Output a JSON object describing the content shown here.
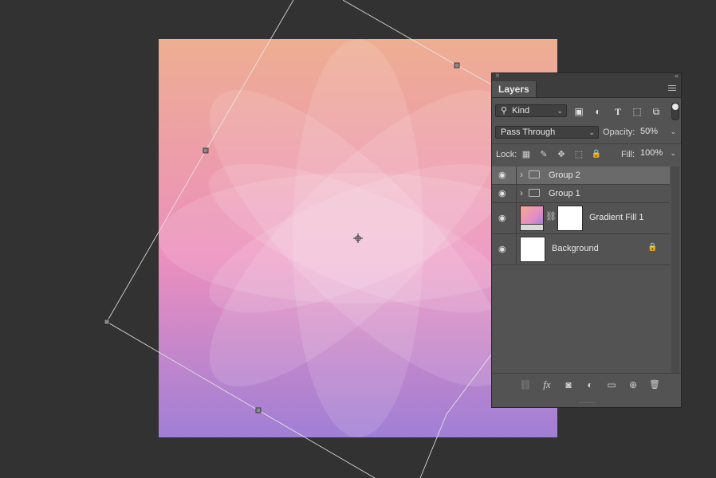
{
  "canvas": {
    "gradient": {
      "top": "#eeae92",
      "middle": "#ec8fbe",
      "bottom": "#a07fd6"
    }
  },
  "panel": {
    "close_glyph": "×",
    "collapse_glyph": "‹‹",
    "tab_label": "Layers",
    "filter": {
      "kind_label": "Kind",
      "search_icon": "⚲",
      "icons": [
        "image-filter-icon",
        "adjustment-filter-icon",
        "type-filter-icon",
        "shape-filter-icon",
        "smart-object-filter-icon"
      ],
      "glyphs": {
        "image": "▣",
        "adjustment": "◐",
        "type": "T",
        "shape": "⬚",
        "smart": "⧉"
      }
    },
    "blend_mode": "Pass Through",
    "opacity_label": "Opacity:",
    "opacity_value": "50%",
    "lock_label": "Lock:",
    "lock_glyphs": {
      "transparent": "▦",
      "brush": "✎",
      "move": "✥",
      "artboard": "⬚",
      "all": "🔒"
    },
    "fill_label": "Fill:",
    "fill_value": "100%",
    "layers": [
      {
        "name": "Group 2",
        "type": "group",
        "selected": true
      },
      {
        "name": "Group 1",
        "type": "group",
        "selected": false
      },
      {
        "name": "Gradient Fill 1",
        "type": "fill",
        "selected": false
      },
      {
        "name": "Background",
        "type": "background",
        "locked": true,
        "selected": false
      }
    ],
    "eye_glyph": "◉",
    "expand_glyph": "›",
    "link_glyph": "⛓",
    "lock_glyph": "🔒",
    "bottom_glyphs": {
      "link": "⛓",
      "fx": "fx",
      "mask": "◙",
      "adjustment": "◐",
      "group": "▭",
      "new": "⊕",
      "delete": "🗑"
    }
  }
}
